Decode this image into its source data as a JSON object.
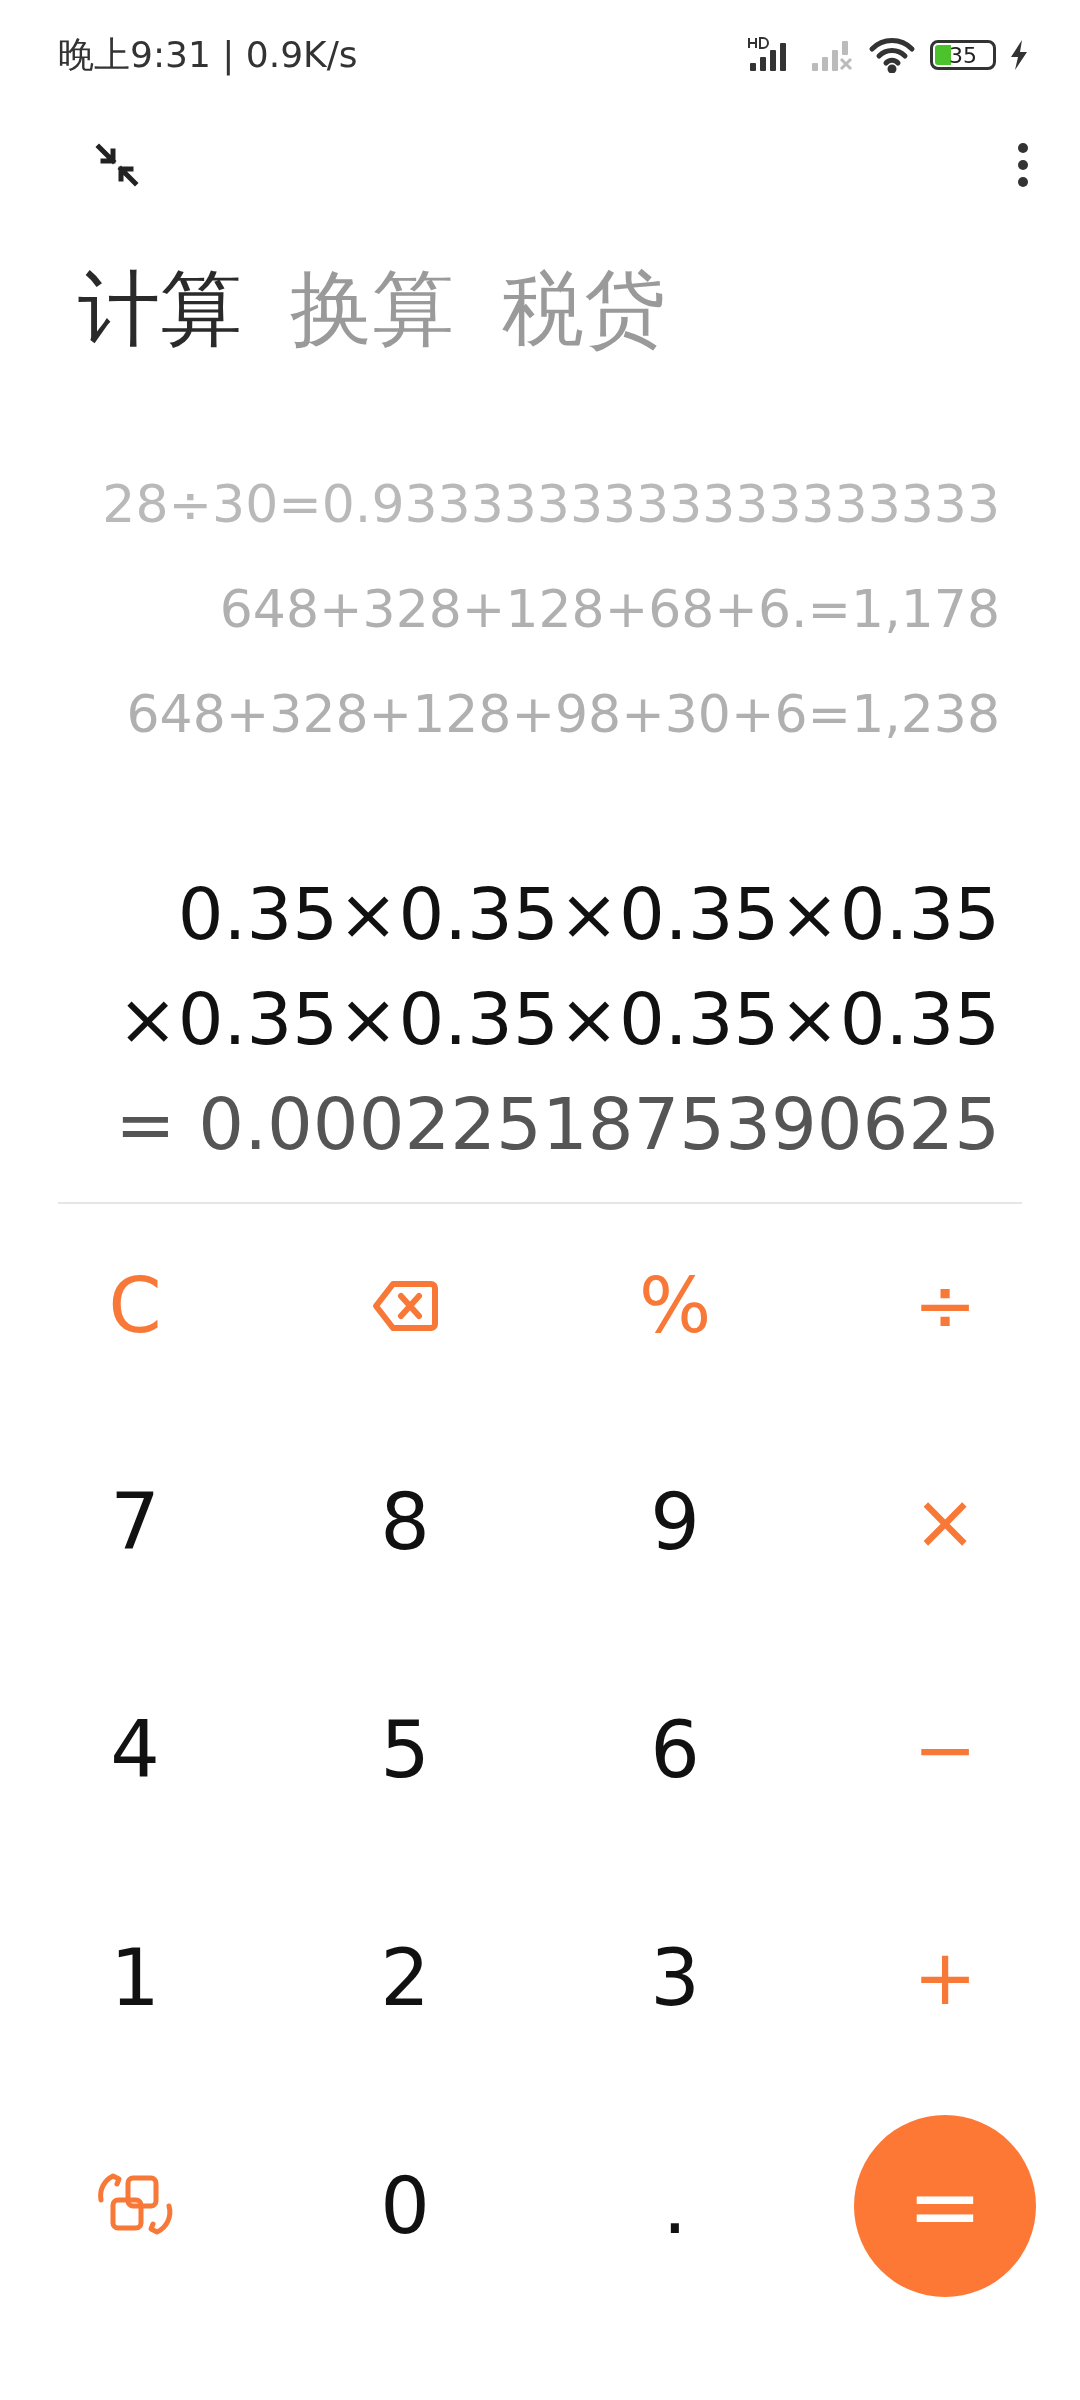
{
  "status_bar": {
    "time": "晚上9:31 | 0.9K/s",
    "battery": "35"
  },
  "tabs": [
    {
      "label": "计算",
      "selected": true
    },
    {
      "label": "换算",
      "selected": false
    },
    {
      "label": "税贷",
      "selected": false
    }
  ],
  "history": [
    "28÷30=0.9333333333333333333",
    "648+328+128+68+6.=1,178",
    "648+328+128+98+30+6=1,238"
  ],
  "expression": [
    "0.35×0.35×0.35×0.35",
    "×0.35×0.35×0.35×0.35"
  ],
  "result": "= 0.0002251875390625",
  "keys": [
    {
      "kind": "op",
      "label": "C"
    },
    {
      "kind": "backspace"
    },
    {
      "kind": "op",
      "label": "%"
    },
    {
      "kind": "op",
      "label": "÷"
    },
    {
      "kind": "digit",
      "label": "7"
    },
    {
      "kind": "digit",
      "label": "8"
    },
    {
      "kind": "digit",
      "label": "9"
    },
    {
      "kind": "op",
      "label": "×"
    },
    {
      "kind": "digit",
      "label": "4"
    },
    {
      "kind": "digit",
      "label": "5"
    },
    {
      "kind": "digit",
      "label": "6"
    },
    {
      "kind": "op",
      "label": "−"
    },
    {
      "kind": "digit",
      "label": "1"
    },
    {
      "kind": "digit",
      "label": "2"
    },
    {
      "kind": "digit",
      "label": "3"
    },
    {
      "kind": "op",
      "label": "+"
    },
    {
      "kind": "swap"
    },
    {
      "kind": "digit",
      "label": "0"
    },
    {
      "kind": "digit",
      "label": "."
    },
    {
      "kind": "equals",
      "label": "="
    }
  ]
}
